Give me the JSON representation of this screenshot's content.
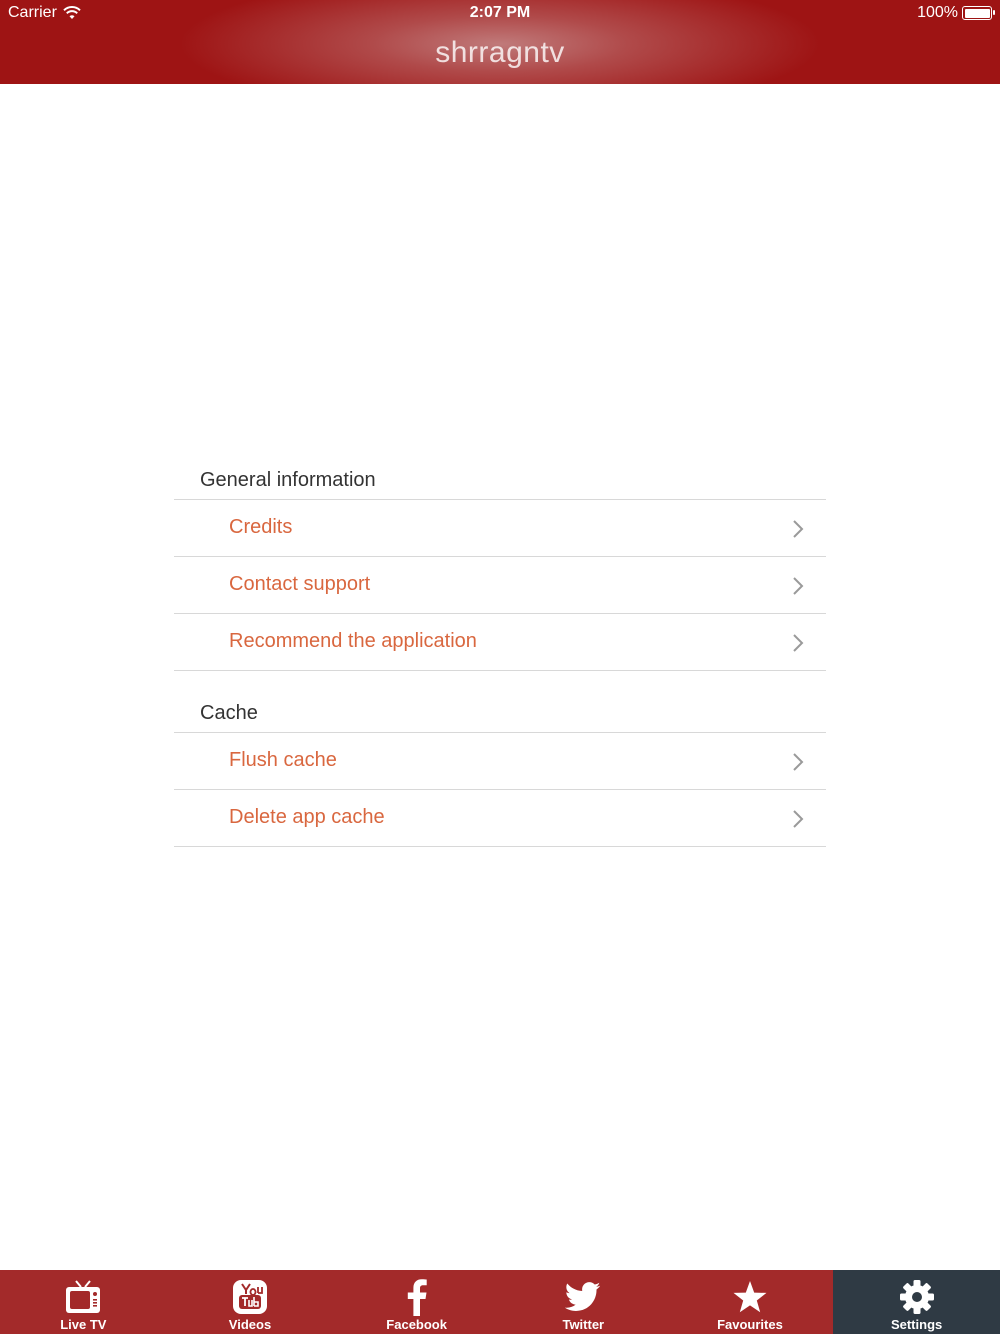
{
  "status": {
    "carrier": "Carrier",
    "time": "2:07 PM",
    "battery": "100%"
  },
  "nav": {
    "title": "shrragntv"
  },
  "sections": [
    {
      "header": "General information",
      "items": [
        "Credits",
        "Contact support",
        "Recommend the application"
      ]
    },
    {
      "header": "Cache",
      "items": [
        "Flush cache",
        "Delete app cache"
      ]
    }
  ],
  "tabs": [
    {
      "label": "Live TV",
      "icon": "tv-icon"
    },
    {
      "label": "Videos",
      "icon": "youtube-icon"
    },
    {
      "label": "Facebook",
      "icon": "facebook-icon"
    },
    {
      "label": "Twitter",
      "icon": "twitter-icon"
    },
    {
      "label": "Favourites",
      "icon": "star-icon"
    },
    {
      "label": "Settings",
      "icon": "gear-icon",
      "active": true
    }
  ],
  "colors": {
    "bar": "#a32a2a",
    "accent": "#d9673f",
    "active_tab": "#2f3a44"
  }
}
